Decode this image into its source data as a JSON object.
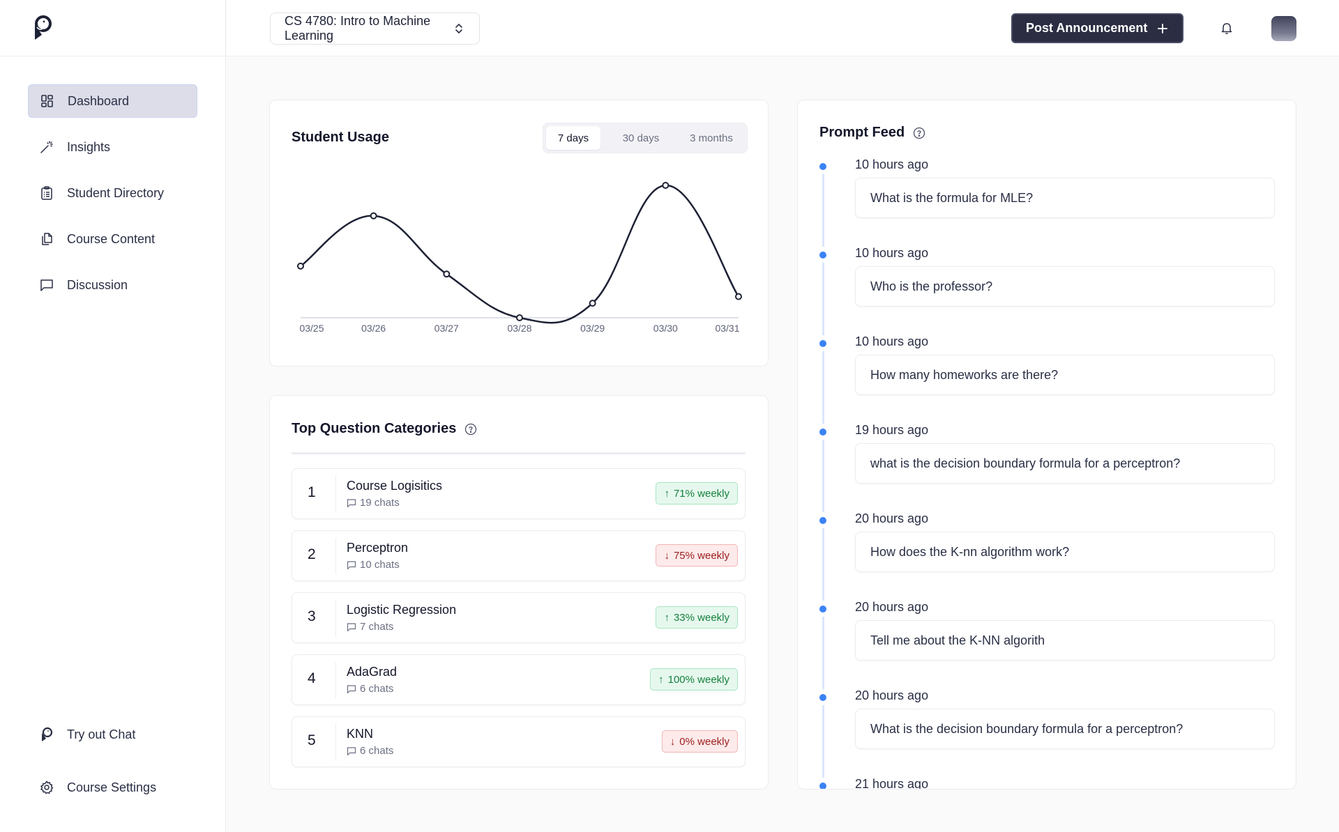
{
  "sidebar": {
    "logo": "pingpong-logo",
    "items": [
      {
        "label": "Dashboard",
        "icon": "dashboard-icon",
        "active": true
      },
      {
        "label": "Insights",
        "icon": "magic-wand-icon",
        "active": false
      },
      {
        "label": "Student Directory",
        "icon": "clipboard-list-icon",
        "active": false
      },
      {
        "label": "Course Content",
        "icon": "documents-icon",
        "active": false
      },
      {
        "label": "Discussion",
        "icon": "message-square-icon",
        "active": false
      }
    ],
    "bottom_items": [
      {
        "label": "Try out Chat",
        "icon": "bird-logo-icon"
      },
      {
        "label": "Course Settings",
        "icon": "gear-icon"
      }
    ]
  },
  "topbar": {
    "course_select": "CS 4780: Intro to Machine Learning",
    "post_button": "Post Announcement",
    "bell_icon": "bell-icon",
    "avatar": "user-avatar"
  },
  "usage": {
    "title": "Student Usage",
    "ranges": [
      "7 days",
      "30 days",
      "3 months"
    ],
    "active_range": "7 days"
  },
  "chart_data": {
    "type": "line",
    "title": "Student Usage",
    "categories": [
      "03/25",
      "03/26",
      "03/27",
      "03/28",
      "03/29",
      "03/30",
      "03/31"
    ],
    "series": [
      {
        "name": "usage",
        "values": [
          39,
          77,
          33,
          0,
          11,
          100,
          16
        ]
      }
    ],
    "xlabel": "",
    "ylabel": "",
    "ylim": [
      0,
      100
    ],
    "grid": false,
    "legend": "none",
    "note": "Relative values (no y-axis shown); 03/30 peak normalized to 100"
  },
  "categories": {
    "title": "Top Question Categories",
    "rows": [
      {
        "rank": "1",
        "name": "Course Logisitics",
        "chats": "19 chats",
        "trend": "up",
        "change": "71% weekly"
      },
      {
        "rank": "2",
        "name": "Perceptron",
        "chats": "10 chats",
        "trend": "down",
        "change": "75% weekly"
      },
      {
        "rank": "3",
        "name": "Logistic Regression",
        "chats": "7 chats",
        "trend": "up",
        "change": "33% weekly"
      },
      {
        "rank": "4",
        "name": "AdaGrad",
        "chats": "6 chats",
        "trend": "up",
        "change": "100% weekly"
      },
      {
        "rank": "5",
        "name": "KNN",
        "chats": "6 chats",
        "trend": "down",
        "change": "0% weekly"
      }
    ]
  },
  "feed": {
    "title": "Prompt Feed",
    "items": [
      {
        "time": "10 hours ago",
        "prompt": "What is the formula for MLE?"
      },
      {
        "time": "10 hours ago",
        "prompt": "Who is the professor?"
      },
      {
        "time": "10 hours ago",
        "prompt": "How many homeworks are there?"
      },
      {
        "time": "19 hours ago",
        "prompt": "what is the decision boundary formula for a perceptron?"
      },
      {
        "time": "20 hours ago",
        "prompt": "How does the K-nn algorithm work?"
      },
      {
        "time": "20 hours ago",
        "prompt": "Tell me about the K-NN algorith"
      },
      {
        "time": "20 hours ago",
        "prompt": "What is the decision boundary formula for a perceptron?"
      },
      {
        "time": "21 hours ago",
        "prompt": ""
      }
    ]
  },
  "colors": {
    "primary_dark": "#2b2d42",
    "accent_blue": "#3b82f6",
    "up_green": "#15803d",
    "down_red": "#9b1c1c",
    "line": "#1e2235"
  }
}
